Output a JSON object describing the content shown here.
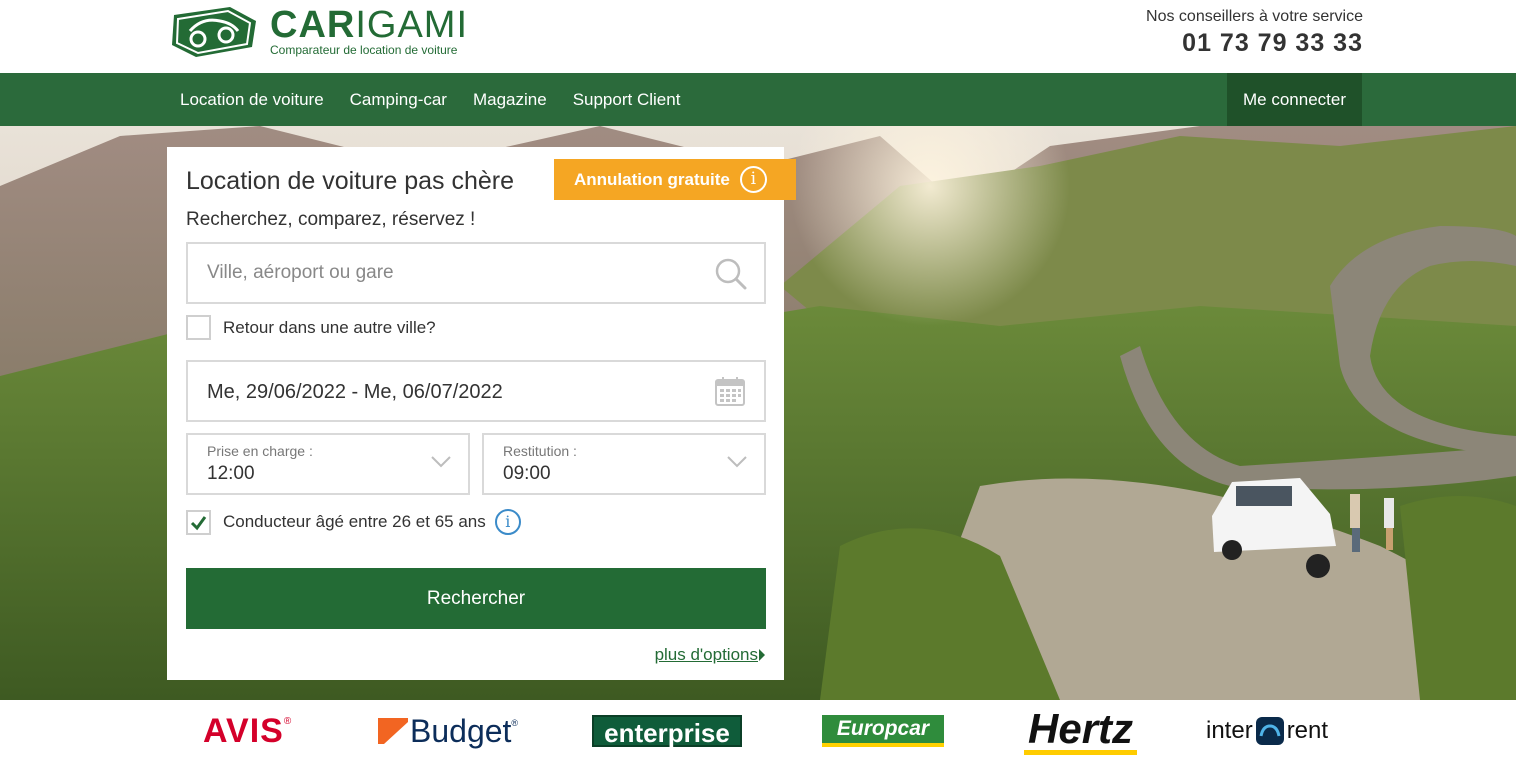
{
  "header": {
    "logo_name_bold": "CAR",
    "logo_name_light": "IGAMI",
    "logo_tagline": "Comparateur de location de voiture",
    "contact_label": "Nos conseillers à votre service",
    "contact_phone": "01 73 79 33 33"
  },
  "nav": {
    "items": [
      {
        "label": "Location de voiture"
      },
      {
        "label": "Camping-car"
      },
      {
        "label": "Magazine"
      },
      {
        "label": "Support Client"
      }
    ],
    "login_label": "Me connecter"
  },
  "search_form": {
    "title": "Location de voiture pas chère",
    "badge_label": "Annulation gratuite",
    "subtitle": "Recherchez, comparez, réservez !",
    "location_placeholder": "Ville, aéroport ou gare",
    "return_other_city_label": "Retour dans une autre ville?",
    "return_other_city_checked": false,
    "dates_value": "Me, 29/06/2022 - Me, 06/07/2022",
    "pickup": {
      "label": "Prise en charge :",
      "value": "12:00"
    },
    "return": {
      "label": "Restitution :",
      "value": "09:00"
    },
    "driver_age_label": "Conducteur âgé entre 26 et 65 ans",
    "driver_age_checked": true,
    "submit_label": "Rechercher",
    "more_options_label": "plus d'options"
  },
  "brands": {
    "avis": "AVIS",
    "budget": "Budget",
    "enterprise": "enterprise",
    "europcar": "Europcar",
    "hertz": "Hertz",
    "interrent_left": "inter",
    "interrent_right": "rent"
  },
  "colors": {
    "brand_green": "#236b35",
    "nav_green": "#2b6a3b",
    "badge_orange": "#f5a623",
    "info_blue": "#3b8bc9"
  }
}
